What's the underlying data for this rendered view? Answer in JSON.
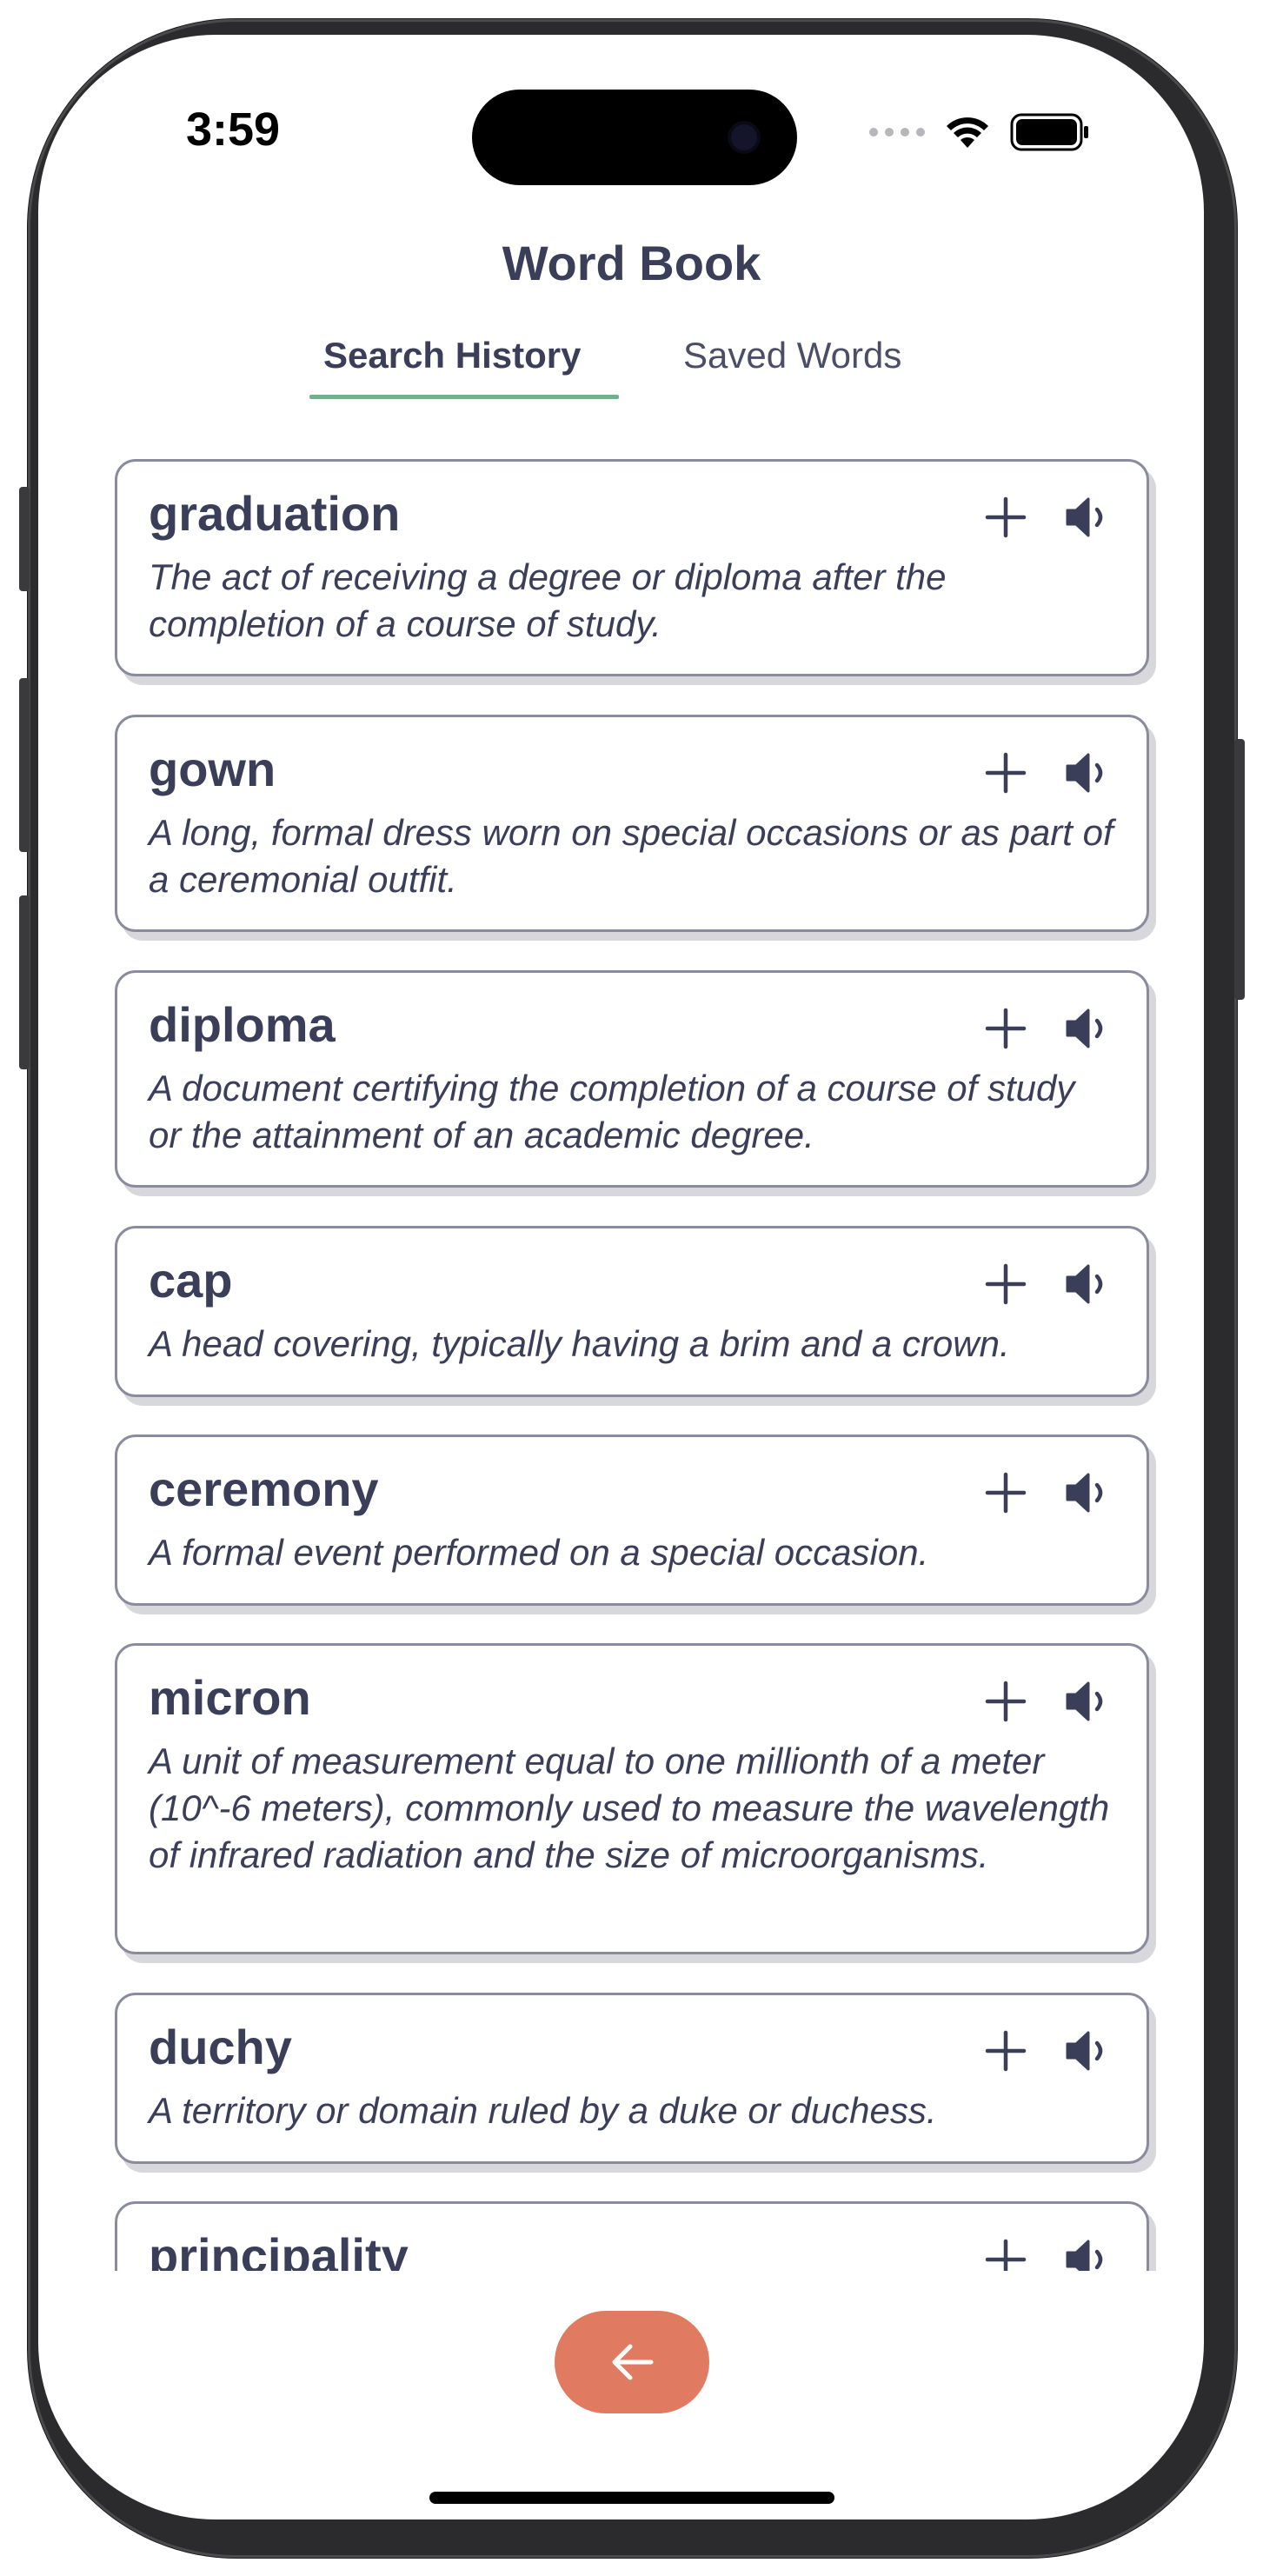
{
  "status_bar": {
    "time": "3:59"
  },
  "header": {
    "title": "Word Book"
  },
  "tabs": [
    {
      "label": "Search History",
      "active": true
    },
    {
      "label": "Saved Words",
      "active": false
    }
  ],
  "entries": [
    {
      "word": "graduation",
      "definition": "The act of receiving a degree or diploma after the completion of a course of study."
    },
    {
      "word": "gown",
      "definition": "A long, formal dress worn on special occasions or as part of a ceremonial outfit."
    },
    {
      "word": "diploma",
      "definition": "A document certifying the completion of a course of study or the attainment of an academic degree."
    },
    {
      "word": "cap",
      "definition": "A head covering, typically having a brim and a crown."
    },
    {
      "word": "ceremony",
      "definition": "A formal event performed on a special occasion."
    },
    {
      "word": "micron",
      "definition": "A unit of measurement equal to one millionth of a meter (10^-6 meters), commonly used to measure the wavelength of infrared radiation and the size of microorganisms."
    },
    {
      "word": "duchy",
      "definition": "A territory or domain ruled by a duke or duchess."
    },
    {
      "word": "principality",
      "definition": ""
    }
  ],
  "icons": {
    "add": "plus-icon",
    "speak": "speaker-icon",
    "back": "arrow-left-icon"
  },
  "colors": {
    "text": "#3b3e58",
    "tab_underline": "#6fb08f",
    "back_button": "#e07b62",
    "card_border": "#8a8c9e"
  }
}
